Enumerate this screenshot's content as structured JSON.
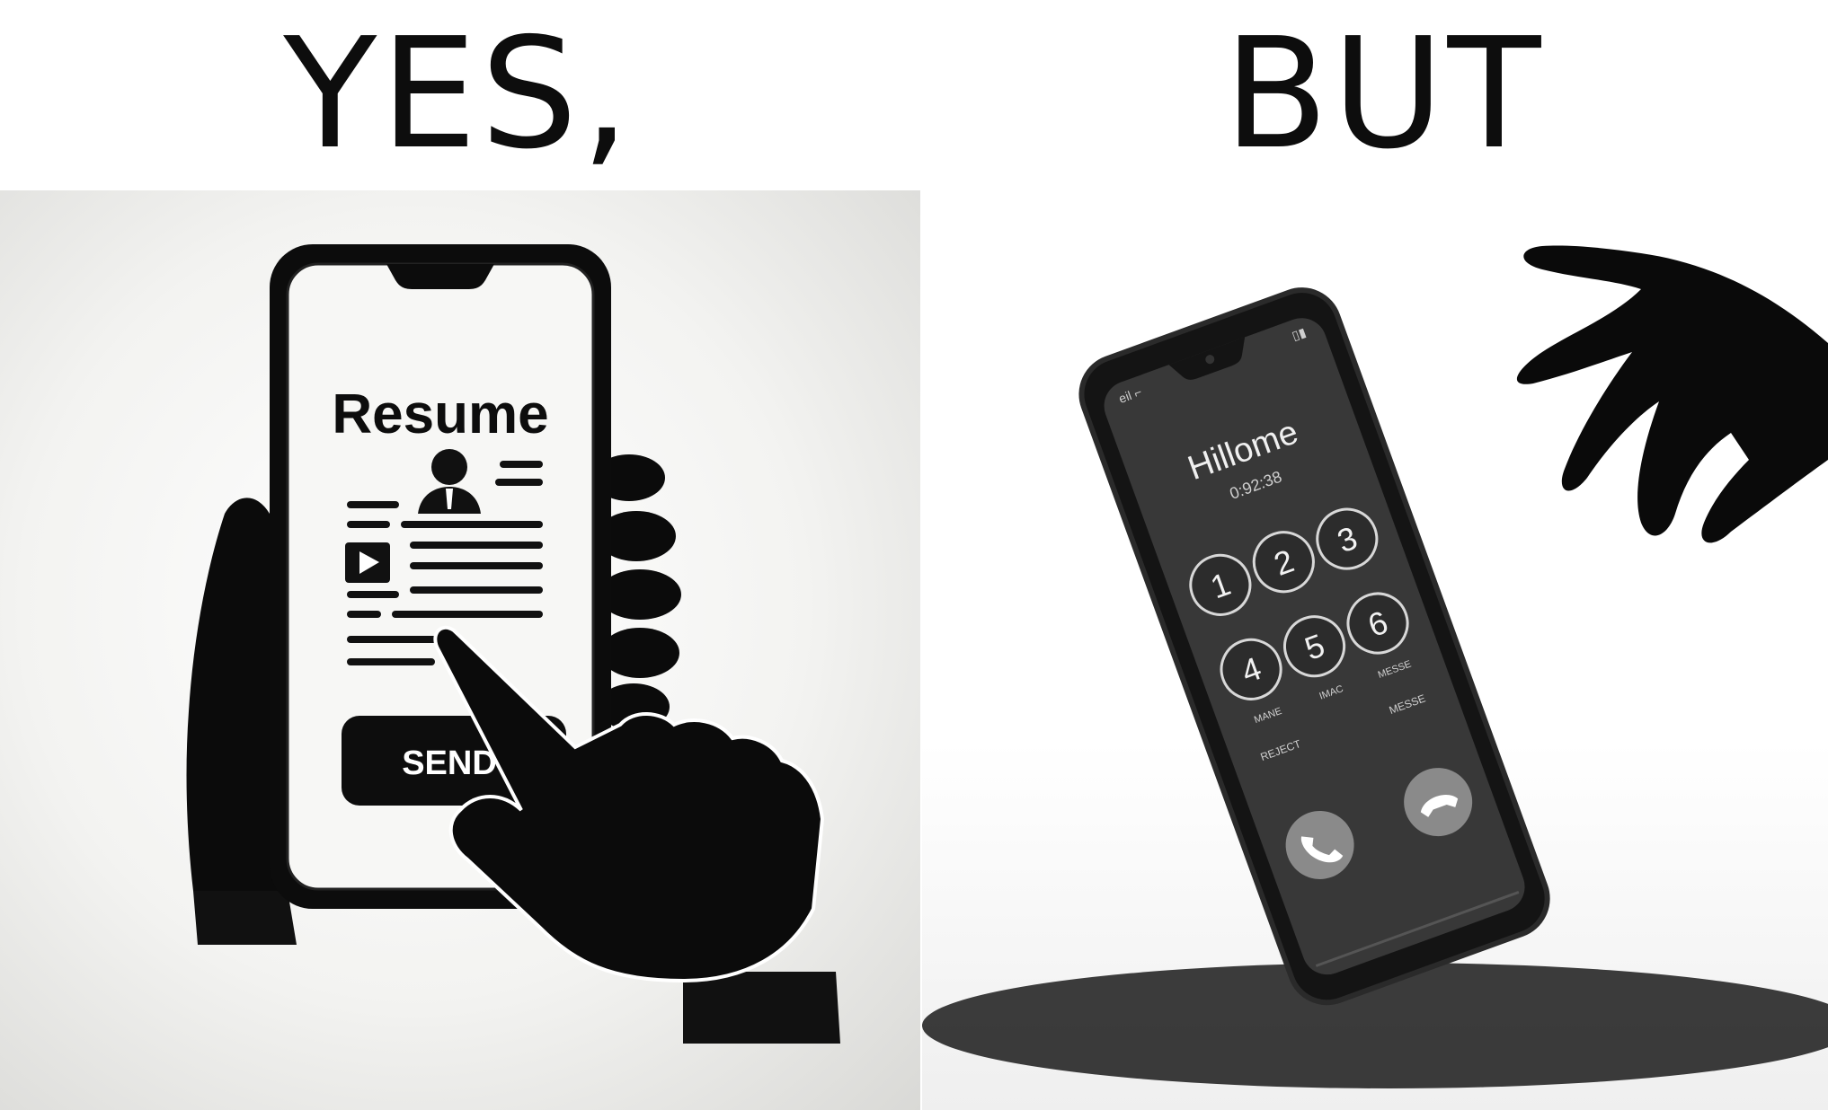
{
  "captions": {
    "left": "YES,",
    "right": "BUT"
  },
  "left_panel": {
    "resume_title": "Resume",
    "send_button_label": "SEND"
  },
  "right_panel": {
    "caller_name": "Hillome",
    "call_timer": "0:92:38",
    "keypad_keys": [
      "1",
      "2",
      "3",
      "4",
      "5",
      "6"
    ],
    "key_sublabels": [
      "MANE",
      "IMAC",
      "MESSE"
    ],
    "reject_label": "REJECT",
    "mute_label": "MESSE",
    "status_left": "eil ⌐",
    "status_right": "▯▮"
  }
}
